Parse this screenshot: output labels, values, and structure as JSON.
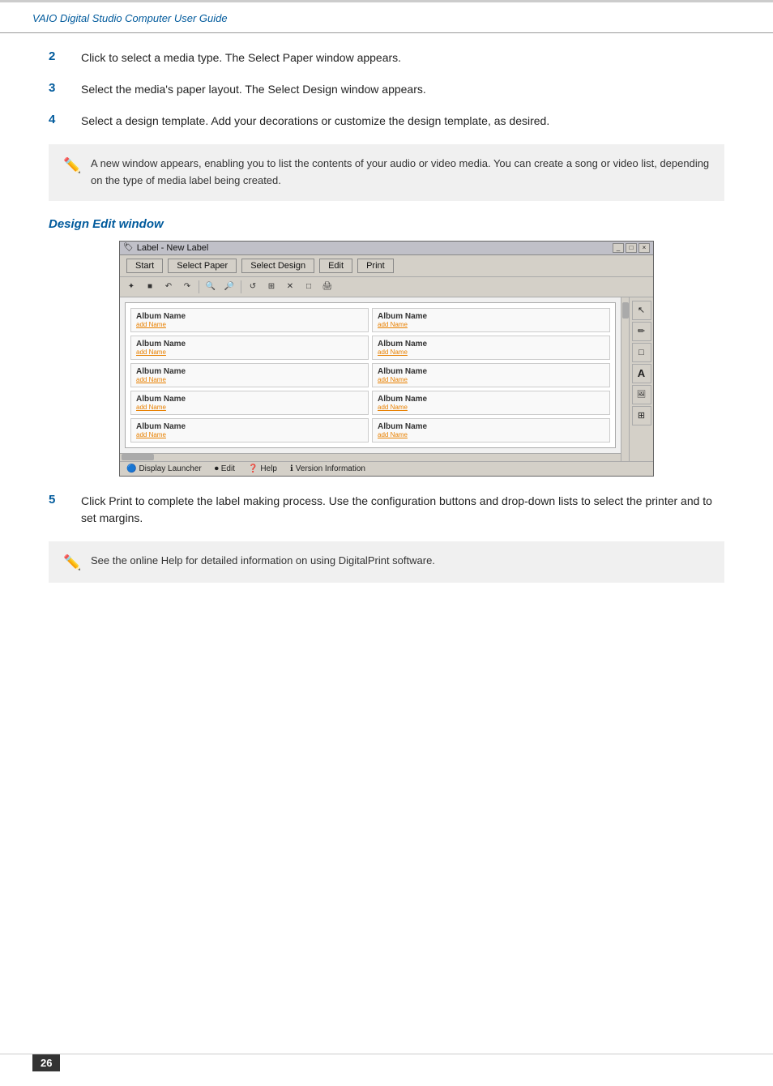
{
  "header": {
    "title": "VAIO Digital Studio Computer User Guide"
  },
  "steps": [
    {
      "number": "2",
      "text": "Click to select a media type. The Select Paper window appears."
    },
    {
      "number": "3",
      "text": "Select the media's paper layout. The Select Design window appears."
    },
    {
      "number": "4",
      "text": "Select a design template. Add your decorations or customize the design template, as desired."
    }
  ],
  "note1": {
    "text": "A new window appears, enabling you to list the contents of your audio or video media. You can create a song or video list, depending on the type of media label being created."
  },
  "section": {
    "heading": "Design Edit window"
  },
  "app_window": {
    "title": "Label - New Label",
    "title_icon": "🏷",
    "controls": [
      "_",
      "□",
      "×"
    ],
    "toolbar_buttons": [
      "Start",
      "Select Paper",
      "Select Design",
      "Edit",
      "Print"
    ],
    "icon_tools": [
      "✦",
      "■",
      "↶",
      "↷",
      "🔍+",
      "🔍-",
      "↺",
      "⊞",
      "✕",
      "□",
      "🖨"
    ],
    "album_rows": [
      [
        "Album Name\nadd Name",
        "Album Name\nadd Name"
      ],
      [
        "Album Name\nadd Name",
        "Album Name\nadd Name"
      ],
      [
        "Album Name\nadd Name",
        "Album Name\nadd Name"
      ],
      [
        "Album Name\nadd Name",
        "Album Name\nadd Name"
      ],
      [
        "Album Name\nadd Name",
        "Album Name\nadd Name"
      ]
    ],
    "right_tools": [
      "↖",
      "✏",
      "□",
      "A",
      "🖼",
      "⊞"
    ],
    "statusbar_items": [
      "Display Launcher",
      "Edit",
      "Help",
      "Version Information"
    ]
  },
  "step5": {
    "number": "5",
    "text": "Click Print to complete the label making process. Use the configuration buttons and drop-down lists to select the printer and to set margins."
  },
  "note2": {
    "text": "See the online Help for detailed information on using DigitalPrint software."
  },
  "footer": {
    "page_number": "26"
  }
}
